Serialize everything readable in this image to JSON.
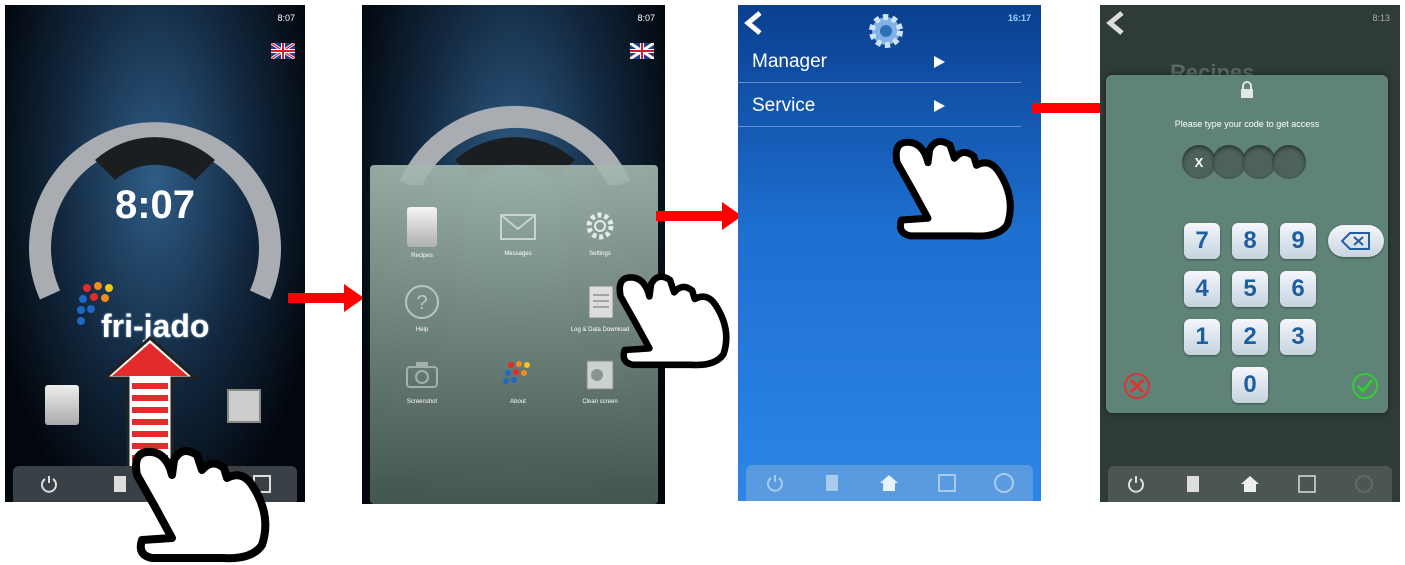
{
  "screen1": {
    "clock": "8:07",
    "time_display": "8:07",
    "logo": "fri-jado",
    "flag_icon": "uk-flag-icon"
  },
  "screen2": {
    "clock": "8:07",
    "tiles": [
      "Recipes",
      "Messages",
      "Settings",
      "Help",
      "Log & Data Download",
      "Screenshot",
      "About",
      "Clean screen"
    ]
  },
  "screen3": {
    "clock": "16:17",
    "menu": [
      "Manager",
      "Service"
    ]
  },
  "screen4": {
    "clock": "8:13",
    "background_title": "Recipes",
    "prompt": "Please type your code to get access",
    "pin_first": "X",
    "keys": [
      "7",
      "8",
      "9",
      "4",
      "5",
      "6",
      "1",
      "2",
      "3",
      "0"
    ]
  },
  "colors": {
    "arrow": "#ff0000",
    "blue_screen": "#1d6fd0",
    "dialog": "#5f8377",
    "key_text": "#1e5fa0"
  }
}
